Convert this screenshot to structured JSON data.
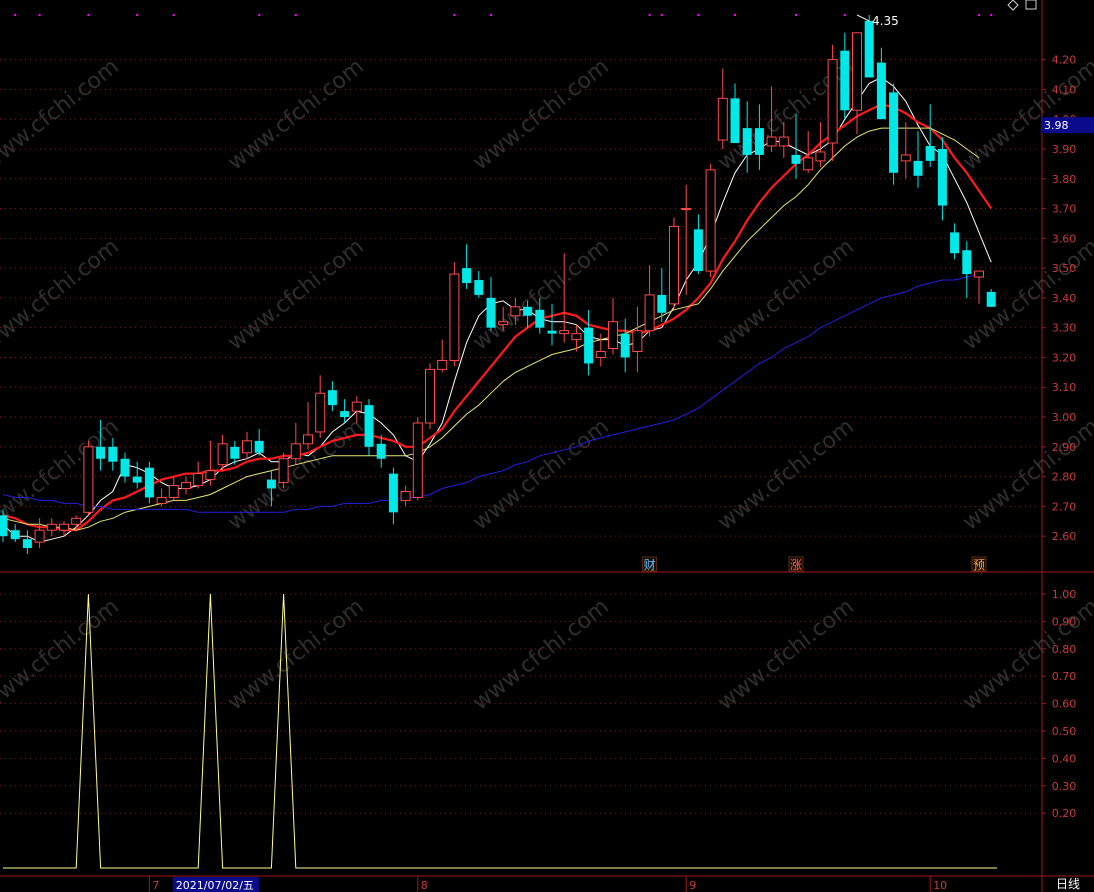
{
  "colors": {
    "background": "#000000",
    "frame": "#a01818",
    "grid": "#8a1616",
    "axis_text": "#c83a3a",
    "up": "#ff4a4a",
    "down": "#00e8e8",
    "ma_white": "#ffffff",
    "ma_red": "#ff1a1a",
    "ma_yellow": "#e8e870",
    "ma_blue": "#2020e0",
    "indicator": "#ffff88",
    "dots": "#ff00ff",
    "watermark": "#ffffff",
    "price_tag_bg": "#0a0a8a",
    "price_tag_text": "#ffffff"
  },
  "watermark_text": "www.cfchi.com",
  "chart_data": [
    {
      "type": "candlestick",
      "ylim": [
        2.52,
        4.38
      ],
      "y_ticks": [
        "2.60",
        "2.70",
        "2.80",
        "2.90",
        "3.00",
        "3.10",
        "3.20",
        "3.30",
        "3.40",
        "3.50",
        "3.60",
        "3.70",
        "3.80",
        "3.90",
        "4.00",
        "4.10",
        "4.20"
      ],
      "y_tick_values": [
        2.6,
        2.7,
        2.8,
        2.9,
        3.0,
        3.1,
        3.2,
        3.3,
        3.4,
        3.5,
        3.6,
        3.7,
        3.8,
        3.9,
        4.0,
        4.1,
        4.2
      ],
      "x_labels": [
        {
          "index": 12,
          "text": "7"
        },
        {
          "index": 14,
          "text": "2021/07/02/五",
          "highlight": true
        },
        {
          "index": 34,
          "text": "8"
        },
        {
          "index": 56,
          "text": "9"
        },
        {
          "index": 76,
          "text": "10"
        }
      ],
      "high_annotation": {
        "index": 70,
        "value": 4.35,
        "text": "4.35"
      },
      "price_tag": {
        "value": 3.98,
        "text": "3.98"
      },
      "event_markers": [
        {
          "index": 53,
          "text": "财"
        },
        {
          "index": 65,
          "text": "涨"
        },
        {
          "index": 80,
          "text": "预"
        }
      ],
      "top_dots": [
        1,
        3,
        7,
        11,
        14,
        21,
        24,
        37,
        40,
        53,
        54,
        57,
        60,
        65,
        69,
        80,
        81
      ],
      "candles": [
        {
          "o": 2.67,
          "h": 2.69,
          "l": 2.58,
          "c": 2.6
        },
        {
          "o": 2.62,
          "h": 2.64,
          "l": 2.58,
          "c": 2.59
        },
        {
          "o": 2.59,
          "h": 2.62,
          "l": 2.54,
          "c": 2.56
        },
        {
          "o": 2.58,
          "h": 2.66,
          "l": 2.56,
          "c": 2.62
        },
        {
          "o": 2.62,
          "h": 2.66,
          "l": 2.6,
          "c": 2.64
        },
        {
          "o": 2.62,
          "h": 2.65,
          "l": 2.6,
          "c": 2.64
        },
        {
          "o": 2.64,
          "h": 2.67,
          "l": 2.62,
          "c": 2.66
        },
        {
          "o": 2.68,
          "h": 2.92,
          "l": 2.67,
          "c": 2.9
        },
        {
          "o": 2.9,
          "h": 2.99,
          "l": 2.82,
          "c": 2.86
        },
        {
          "o": 2.9,
          "h": 2.93,
          "l": 2.82,
          "c": 2.85
        },
        {
          "o": 2.86,
          "h": 2.88,
          "l": 2.78,
          "c": 2.8
        },
        {
          "o": 2.8,
          "h": 2.85,
          "l": 2.76,
          "c": 2.78
        },
        {
          "o": 2.83,
          "h": 2.85,
          "l": 2.71,
          "c": 2.73
        },
        {
          "o": 2.71,
          "h": 2.76,
          "l": 2.7,
          "c": 2.73
        },
        {
          "o": 2.73,
          "h": 2.8,
          "l": 2.72,
          "c": 2.77
        },
        {
          "o": 2.76,
          "h": 2.8,
          "l": 2.74,
          "c": 2.78
        },
        {
          "o": 2.77,
          "h": 2.85,
          "l": 2.76,
          "c": 2.81
        },
        {
          "o": 2.79,
          "h": 2.92,
          "l": 2.77,
          "c": 2.82
        },
        {
          "o": 2.84,
          "h": 2.94,
          "l": 2.82,
          "c": 2.91
        },
        {
          "o": 2.9,
          "h": 2.92,
          "l": 2.84,
          "c": 2.86
        },
        {
          "o": 2.88,
          "h": 2.95,
          "l": 2.86,
          "c": 2.92
        },
        {
          "o": 2.92,
          "h": 2.96,
          "l": 2.87,
          "c": 2.88
        },
        {
          "o": 2.79,
          "h": 2.82,
          "l": 2.7,
          "c": 2.76
        },
        {
          "o": 2.78,
          "h": 2.88,
          "l": 2.76,
          "c": 2.86
        },
        {
          "o": 2.86,
          "h": 2.98,
          "l": 2.84,
          "c": 2.91
        },
        {
          "o": 2.91,
          "h": 3.05,
          "l": 2.89,
          "c": 2.94
        },
        {
          "o": 2.95,
          "h": 3.14,
          "l": 2.93,
          "c": 3.08
        },
        {
          "o": 3.09,
          "h": 3.12,
          "l": 3.02,
          "c": 3.04
        },
        {
          "o": 3.02,
          "h": 3.06,
          "l": 2.98,
          "c": 3.0
        },
        {
          "o": 3.02,
          "h": 3.07,
          "l": 2.98,
          "c": 3.05
        },
        {
          "o": 3.04,
          "h": 3.06,
          "l": 2.87,
          "c": 2.9
        },
        {
          "o": 2.91,
          "h": 2.94,
          "l": 2.83,
          "c": 2.86
        },
        {
          "o": 2.81,
          "h": 2.83,
          "l": 2.64,
          "c": 2.68
        },
        {
          "o": 2.72,
          "h": 2.77,
          "l": 2.7,
          "c": 2.75
        },
        {
          "o": 2.73,
          "h": 3.0,
          "l": 2.72,
          "c": 2.98
        },
        {
          "o": 2.98,
          "h": 3.18,
          "l": 2.96,
          "c": 3.16
        },
        {
          "o": 3.16,
          "h": 3.26,
          "l": 3.15,
          "c": 3.19
        },
        {
          "o": 3.19,
          "h": 3.52,
          "l": 3.17,
          "c": 3.48
        },
        {
          "o": 3.5,
          "h": 3.58,
          "l": 3.43,
          "c": 3.45
        },
        {
          "o": 3.46,
          "h": 3.49,
          "l": 3.4,
          "c": 3.41
        },
        {
          "o": 3.4,
          "h": 3.47,
          "l": 3.29,
          "c": 3.3
        },
        {
          "o": 3.31,
          "h": 3.37,
          "l": 3.29,
          "c": 3.32
        },
        {
          "o": 3.34,
          "h": 3.4,
          "l": 3.31,
          "c": 3.37
        },
        {
          "o": 3.37,
          "h": 3.39,
          "l": 3.3,
          "c": 3.34
        },
        {
          "o": 3.36,
          "h": 3.4,
          "l": 3.28,
          "c": 3.3
        },
        {
          "o": 3.29,
          "h": 3.38,
          "l": 3.24,
          "c": 3.28
        },
        {
          "o": 3.28,
          "h": 3.55,
          "l": 3.25,
          "c": 3.29
        },
        {
          "o": 3.26,
          "h": 3.31,
          "l": 3.22,
          "c": 3.28
        },
        {
          "o": 3.3,
          "h": 3.36,
          "l": 3.14,
          "c": 3.18
        },
        {
          "o": 3.2,
          "h": 3.28,
          "l": 3.17,
          "c": 3.22
        },
        {
          "o": 3.23,
          "h": 3.4,
          "l": 3.21,
          "c": 3.32
        },
        {
          "o": 3.28,
          "h": 3.33,
          "l": 3.15,
          "c": 3.2
        },
        {
          "o": 3.22,
          "h": 3.37,
          "l": 3.15,
          "c": 3.29
        },
        {
          "o": 3.29,
          "h": 3.51,
          "l": 3.27,
          "c": 3.41
        },
        {
          "o": 3.41,
          "h": 3.5,
          "l": 3.32,
          "c": 3.35
        },
        {
          "o": 3.38,
          "h": 3.67,
          "l": 3.36,
          "c": 3.64
        },
        {
          "o": 3.7,
          "h": 3.78,
          "l": 3.41,
          "c": 3.7
        },
        {
          "o": 3.63,
          "h": 3.68,
          "l": 3.48,
          "c": 3.49
        },
        {
          "o": 3.49,
          "h": 3.85,
          "l": 3.47,
          "c": 3.83
        },
        {
          "o": 3.93,
          "h": 4.17,
          "l": 3.9,
          "c": 4.07
        },
        {
          "o": 4.07,
          "h": 4.12,
          "l": 3.96,
          "c": 3.92
        },
        {
          "o": 3.97,
          "h": 4.06,
          "l": 3.82,
          "c": 3.88
        },
        {
          "o": 3.97,
          "h": 4.05,
          "l": 3.83,
          "c": 3.88
        },
        {
          "o": 3.91,
          "h": 4.11,
          "l": 3.89,
          "c": 3.94
        },
        {
          "o": 3.91,
          "h": 3.99,
          "l": 3.87,
          "c": 3.94
        },
        {
          "o": 3.88,
          "h": 4.02,
          "l": 3.8,
          "c": 3.85
        },
        {
          "o": 3.83,
          "h": 3.96,
          "l": 3.82,
          "c": 3.87
        },
        {
          "o": 3.86,
          "h": 3.99,
          "l": 3.84,
          "c": 3.89
        },
        {
          "o": 3.92,
          "h": 4.25,
          "l": 3.86,
          "c": 4.2
        },
        {
          "o": 4.23,
          "h": 4.29,
          "l": 4.0,
          "c": 4.03
        },
        {
          "o": 4.03,
          "h": 4.29,
          "l": 3.95,
          "c": 4.29
        },
        {
          "o": 4.33,
          "h": 4.35,
          "l": 4.14,
          "c": 4.14
        },
        {
          "o": 4.19,
          "h": 4.24,
          "l": 4.0,
          "c": 4.0
        },
        {
          "o": 4.09,
          "h": 4.12,
          "l": 3.78,
          "c": 3.82
        },
        {
          "o": 3.86,
          "h": 3.99,
          "l": 3.8,
          "c": 3.88
        },
        {
          "o": 3.86,
          "h": 3.96,
          "l": 3.77,
          "c": 3.81
        },
        {
          "o": 3.91,
          "h": 4.05,
          "l": 3.84,
          "c": 3.86
        },
        {
          "o": 3.9,
          "h": 3.94,
          "l": 3.66,
          "c": 3.71
        },
        {
          "o": 3.62,
          "h": 3.65,
          "l": 3.53,
          "c": 3.55
        },
        {
          "o": 3.56,
          "h": 3.59,
          "l": 3.4,
          "c": 3.48
        },
        {
          "o": 3.47,
          "h": 3.49,
          "l": 3.38,
          "c": 3.49
        },
        {
          "o": 3.42,
          "h": 3.43,
          "l": 3.37,
          "c": 3.37
        }
      ],
      "series": [
        {
          "key": "ma_white",
          "values": [
            2.64,
            2.6,
            2.6,
            2.58,
            2.59,
            2.6,
            2.63,
            2.67,
            2.72,
            2.75,
            2.84,
            2.83,
            2.81,
            2.78,
            2.76,
            2.76,
            2.77,
            2.79,
            2.83,
            2.85,
            2.86,
            2.88,
            2.85,
            2.85,
            2.88,
            2.87,
            2.9,
            2.95,
            2.98,
            3.02,
            3.01,
            2.98,
            2.94,
            2.87,
            2.85,
            2.91,
            2.98,
            3.12,
            3.25,
            3.34,
            3.38,
            3.39,
            3.36,
            3.36,
            3.33,
            3.32,
            3.32,
            3.31,
            3.27,
            3.26,
            3.26,
            3.24,
            3.25,
            3.29,
            3.3,
            3.37,
            3.46,
            3.52,
            3.61,
            3.72,
            3.82,
            3.88,
            3.9,
            3.93,
            3.92,
            3.9,
            3.88,
            3.9,
            3.93,
            4.0,
            4.06,
            4.12,
            4.14,
            4.11,
            4.06,
            3.98,
            3.91,
            3.88,
            3.8,
            3.72,
            3.62,
            3.52
          ]
        },
        {
          "key": "ma_red",
          "values": [
            2.67,
            2.66,
            2.64,
            2.63,
            2.63,
            2.62,
            2.62,
            2.65,
            2.69,
            2.72,
            2.73,
            2.75,
            2.77,
            2.79,
            2.8,
            2.81,
            2.81,
            2.82,
            2.82,
            2.83,
            2.85,
            2.86,
            2.86,
            2.87,
            2.87,
            2.88,
            2.9,
            2.92,
            2.93,
            2.94,
            2.94,
            2.93,
            2.92,
            2.9,
            2.9,
            2.93,
            2.96,
            3.02,
            3.07,
            3.12,
            3.17,
            3.22,
            3.27,
            3.3,
            3.33,
            3.34,
            3.35,
            3.34,
            3.31,
            3.3,
            3.29,
            3.29,
            3.28,
            3.29,
            3.31,
            3.33,
            3.36,
            3.4,
            3.45,
            3.53,
            3.59,
            3.66,
            3.72,
            3.77,
            3.81,
            3.85,
            3.88,
            3.92,
            3.95,
            3.98,
            4.01,
            4.03,
            4.05,
            4.04,
            4.02,
            3.99,
            3.97,
            3.93,
            3.87,
            3.82,
            3.76,
            3.7
          ]
        },
        {
          "key": "ma_yellow",
          "values": [
            2.66,
            2.65,
            2.64,
            2.64,
            2.63,
            2.63,
            2.62,
            2.63,
            2.65,
            2.66,
            2.68,
            2.69,
            2.7,
            2.71,
            2.72,
            2.72,
            2.73,
            2.74,
            2.76,
            2.78,
            2.8,
            2.81,
            2.82,
            2.83,
            2.84,
            2.85,
            2.86,
            2.87,
            2.87,
            2.87,
            2.87,
            2.87,
            2.87,
            2.87,
            2.88,
            2.9,
            2.93,
            2.97,
            3.01,
            3.04,
            3.08,
            3.12,
            3.15,
            3.17,
            3.19,
            3.21,
            3.22,
            3.23,
            3.25,
            3.26,
            3.27,
            3.28,
            3.3,
            3.32,
            3.34,
            3.36,
            3.37,
            3.38,
            3.43,
            3.49,
            3.54,
            3.59,
            3.63,
            3.67,
            3.71,
            3.74,
            3.78,
            3.83,
            3.87,
            3.91,
            3.94,
            3.96,
            3.97,
            3.97,
            3.97,
            3.97,
            3.97,
            3.95,
            3.93,
            3.9,
            3.87
          ]
        },
        {
          "key": "ma_blue",
          "values": [
            2.74,
            2.73,
            2.73,
            2.72,
            2.72,
            2.71,
            2.71,
            2.7,
            2.7,
            2.69,
            2.69,
            2.69,
            2.69,
            2.69,
            2.69,
            2.69,
            2.68,
            2.68,
            2.68,
            2.68,
            2.68,
            2.68,
            2.68,
            2.68,
            2.69,
            2.69,
            2.7,
            2.7,
            2.71,
            2.71,
            2.71,
            2.72,
            2.72,
            2.73,
            2.73,
            2.74,
            2.76,
            2.77,
            2.78,
            2.8,
            2.81,
            2.82,
            2.84,
            2.85,
            2.87,
            2.88,
            2.89,
            2.9,
            2.92,
            2.93,
            2.94,
            2.95,
            2.96,
            2.97,
            2.98,
            2.99,
            3.01,
            3.03,
            3.06,
            3.09,
            3.12,
            3.15,
            3.18,
            3.2,
            3.23,
            3.25,
            3.27,
            3.3,
            3.32,
            3.34,
            3.36,
            3.38,
            3.4,
            3.41,
            3.42,
            3.44,
            3.45,
            3.46,
            3.46,
            3.47,
            3.48
          ]
        }
      ]
    },
    {
      "type": "line",
      "ylim": [
        0.0,
        1.05
      ],
      "y_ticks": [
        "0.20",
        "0.30",
        "0.40",
        "0.50",
        "0.60",
        "0.70",
        "0.80",
        "0.90",
        "1.00"
      ],
      "y_tick_values": [
        0.2,
        0.3,
        0.4,
        0.5,
        0.6,
        0.7,
        0.8,
        0.9,
        1.0
      ],
      "series": [
        {
          "key": "indicator",
          "values": [
            0,
            0,
            0,
            0,
            0,
            0,
            0,
            1,
            0,
            0,
            0,
            0,
            0,
            0,
            0,
            0,
            0,
            1,
            0,
            0,
            0,
            0,
            0,
            1,
            0,
            0,
            0,
            0,
            0,
            0,
            0,
            0,
            0,
            0,
            0,
            0,
            0,
            0,
            0,
            0,
            0,
            0,
            0,
            0,
            0,
            0,
            0,
            0,
            0,
            0,
            0,
            0,
            0,
            0,
            0,
            0,
            0,
            0,
            0,
            0,
            0,
            0,
            0,
            0,
            0,
            0,
            0,
            0,
            0,
            0,
            0,
            0,
            0,
            0,
            0,
            0,
            0,
            0,
            0,
            0,
            0,
            0
          ]
        }
      ]
    }
  ],
  "period_label": "日线"
}
